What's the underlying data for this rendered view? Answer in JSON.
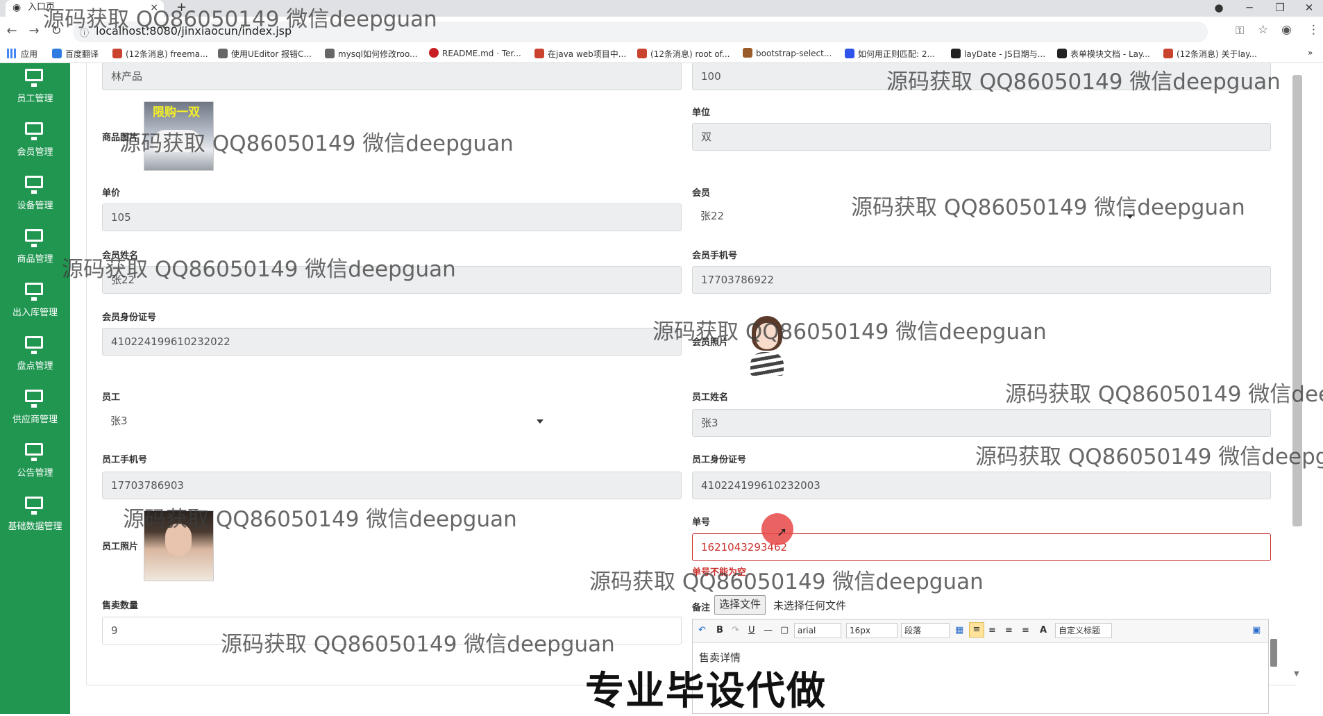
{
  "browser": {
    "tab_title": "入口页",
    "tab_close": "×",
    "new_tab": "+",
    "url": "localhost:8080/jinxiaocun/index.jsp",
    "bookmarks": [
      "应用",
      "百度翻译",
      "(12条消息) freema...",
      "使用UEditor 报错C...",
      "mysql如何修改roo...",
      "README.md · Ter...",
      "在java web项目中...",
      "(12条消息) root of...",
      "bootstrap-select...",
      "如何用正则匹配: 2...",
      "layDate - JS日期与...",
      "表单模块文档 - Lay...",
      "(12条消息) 关于lay..."
    ]
  },
  "sidebar": {
    "items": [
      "员工管理",
      "会员管理",
      "设备管理",
      "商品管理",
      "出入库管理",
      "盘点管理",
      "供应商管理",
      "公告管理",
      "基础数据管理"
    ]
  },
  "form": {
    "product_name_value": "林产品",
    "top_right_value": "100",
    "product_image_label": "商品图片",
    "product_image_text": "限购一双",
    "unit_label": "单位",
    "unit_value": "双",
    "price_label": "单价",
    "price_value": "105",
    "member_label": "会员",
    "member_value": "张22",
    "member_name_label": "会员姓名",
    "member_name_value": "张22",
    "member_phone_label": "会员手机号",
    "member_phone_value": "17703786922",
    "member_id_label": "会员身份证号",
    "member_id_value": "410224199610232022",
    "member_photo_label": "会员照片",
    "employee_label": "员工",
    "employee_value": "张3",
    "employee_name_label": "员工姓名",
    "employee_name_value": "张3",
    "employee_phone_label": "员工手机号",
    "employee_phone_value": "17703786903",
    "employee_id_label": "员工身份证号",
    "employee_id_value": "410224199610232003",
    "order_no_label": "单号",
    "order_no_value": "1621043293462",
    "order_no_error": "单号不能为空",
    "employee_photo_label": "员工照片",
    "quantity_label": "售卖数量",
    "quantity_value": "9",
    "remark_label": "备注",
    "file_button": "选择文件",
    "file_status": "未选择任何文件"
  },
  "editor": {
    "font_family": "arial",
    "font_size": "16px",
    "paragraph": "段落",
    "custom_title": "自定义标题",
    "content": "售卖详情"
  },
  "watermarks": [
    "源码获取 QQ86050149 微信deepguan"
  ],
  "overlay_text": "专业毕设代做",
  "colors": {
    "sidebar": "#209651",
    "error": "#c9302c",
    "input_bg": "#eceeef"
  }
}
